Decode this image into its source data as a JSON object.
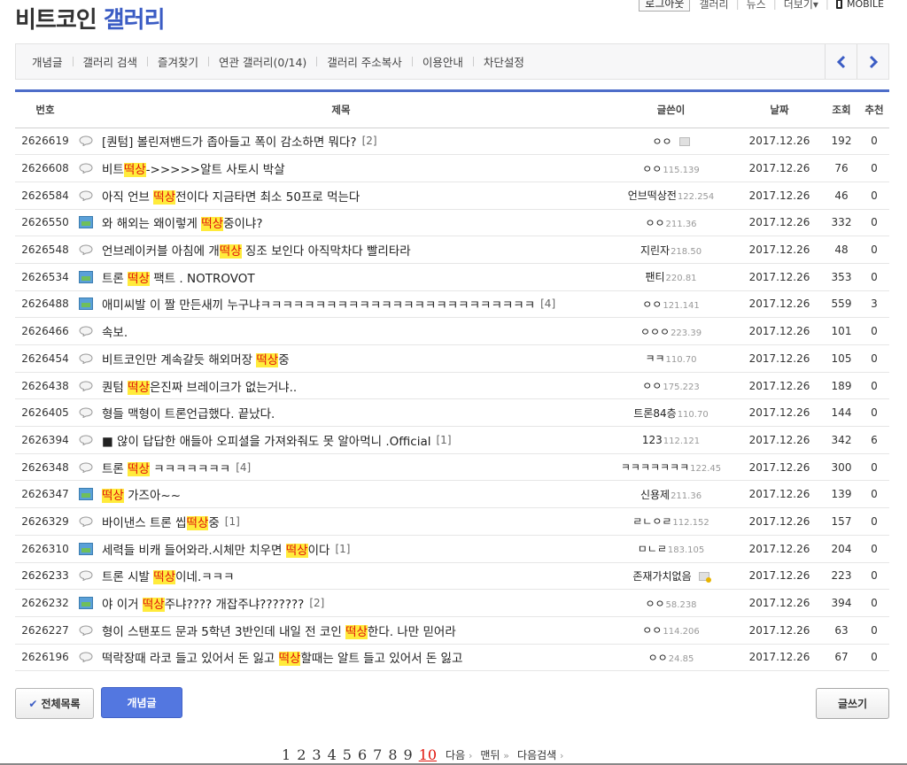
{
  "site": {
    "title_part1": "비트코인",
    "title_part2": "갤러리"
  },
  "topnav": {
    "logout": "로그아웃",
    "gallery": "갤러리",
    "news": "뉴스",
    "more": "더보기",
    "more_caret": "▾",
    "mobile": "MOBILE"
  },
  "menu": {
    "items": [
      "개념글",
      "갤러리 검색",
      "즐겨찾기",
      "연관 갤러리(0/14)",
      "갤러리 주소복사",
      "이용안내",
      "차단설정"
    ]
  },
  "colors": {
    "brand": "#3b5cc4",
    "accent_button": "#5377e0",
    "highlight_bg": "#ffeb3b",
    "highlight_text": "#e0140c"
  },
  "table": {
    "headers": {
      "num": "번호",
      "subject": "제목",
      "writer": "글쓴이",
      "date": "날짜",
      "views": "조회",
      "recommend": "추천"
    },
    "rows": [
      {
        "num": "2626619",
        "icon": "text-icon",
        "parts": [
          {
            "t": "[퀀텀] 볼린져밴드가 좁아들고 폭이 감소하면 뭐다?"
          }
        ],
        "reply": "[2]",
        "writer": "ㅇㅇ",
        "ip": "",
        "badge": "gray",
        "date": "2017.12.26",
        "views": "192",
        "rec": "0"
      },
      {
        "num": "2626608",
        "icon": "text-icon",
        "parts": [
          {
            "t": "비트"
          },
          {
            "t": "떡상",
            "h": true
          },
          {
            "t": "->>>>>알트 사토시 박살"
          }
        ],
        "reply": "",
        "writer": "ㅇㅇ",
        "ip": "115.139",
        "badge": "",
        "date": "2017.12.26",
        "views": "76",
        "rec": "0"
      },
      {
        "num": "2626584",
        "icon": "text-icon",
        "parts": [
          {
            "t": "아직 언브 "
          },
          {
            "t": "떡상",
            "h": true
          },
          {
            "t": "전이다 지금타면 최소 50프로 먹는다"
          }
        ],
        "reply": "",
        "writer": "언브떡상전",
        "ip": "122.254",
        "badge": "",
        "date": "2017.12.26",
        "views": "46",
        "rec": "0"
      },
      {
        "num": "2626550",
        "icon": "image-icon",
        "parts": [
          {
            "t": "와 해외는 왜이렇게 "
          },
          {
            "t": "떡상",
            "h": true
          },
          {
            "t": "중이냐?"
          }
        ],
        "reply": "",
        "writer": "ㅇㅇ",
        "ip": "211.36",
        "badge": "",
        "date": "2017.12.26",
        "views": "332",
        "rec": "0"
      },
      {
        "num": "2626548",
        "icon": "text-icon",
        "parts": [
          {
            "t": "언브레이커블 아침에 개"
          },
          {
            "t": "떡상",
            "h": true
          },
          {
            "t": " 징조 보인다 아직막차다 빨리타라"
          }
        ],
        "reply": "",
        "writer": "지린자",
        "ip": "218.50",
        "badge": "",
        "date": "2017.12.26",
        "views": "48",
        "rec": "0"
      },
      {
        "num": "2626534",
        "icon": "image-icon",
        "parts": [
          {
            "t": "트론 "
          },
          {
            "t": "떡상",
            "h": true
          },
          {
            "t": " 팩트 . NOTROVOT"
          }
        ],
        "reply": "",
        "writer": "팬티",
        "ip": "220.81",
        "badge": "",
        "date": "2017.12.26",
        "views": "353",
        "rec": "0"
      },
      {
        "num": "2626488",
        "icon": "image-icon",
        "parts": [
          {
            "t": "애미씨발 이 짤 만든새끼 누구냐ㅋㅋㅋㅋㅋㅋㅋㅋㅋㅋㅋㅋㅋㅋㅋㅋㅋㅋㅋㅋㅋㅋㅋㅋㅋ"
          }
        ],
        "reply": "[4]",
        "writer": "ㅇㅇ",
        "ip": "121.141",
        "badge": "",
        "date": "2017.12.26",
        "views": "559",
        "rec": "3"
      },
      {
        "num": "2626466",
        "icon": "text-icon",
        "parts": [
          {
            "t": "속보."
          }
        ],
        "reply": "",
        "writer": "ㅇㅇㅇ",
        "ip": "223.39",
        "badge": "",
        "date": "2017.12.26",
        "views": "101",
        "rec": "0"
      },
      {
        "num": "2626454",
        "icon": "text-icon",
        "parts": [
          {
            "t": "비트코인만 계속갈듯 해외머장 "
          },
          {
            "t": "떡상",
            "h": true
          },
          {
            "t": "중"
          }
        ],
        "reply": "",
        "writer": "ㅋㅋ",
        "ip": "110.70",
        "badge": "",
        "date": "2017.12.26",
        "views": "105",
        "rec": "0"
      },
      {
        "num": "2626438",
        "icon": "text-icon",
        "parts": [
          {
            "t": "퀀텀 "
          },
          {
            "t": "떡상",
            "h": true
          },
          {
            "t": "은진짜 브레이크가 없는거냐.."
          }
        ],
        "reply": "",
        "writer": "ㅇㅇ",
        "ip": "175.223",
        "badge": "",
        "date": "2017.12.26",
        "views": "189",
        "rec": "0"
      },
      {
        "num": "2626405",
        "icon": "text-icon",
        "parts": [
          {
            "t": "형들 맥형이 트론언급했다. 끝났다."
          }
        ],
        "reply": "",
        "writer": "트론84층",
        "ip": "110.70",
        "badge": "",
        "date": "2017.12.26",
        "views": "144",
        "rec": "0"
      },
      {
        "num": "2626394",
        "icon": "text-icon",
        "parts": [
          {
            "t": "■ 않이 답답한 애들아 오피셜을 가져와줘도 못 알아먹니 .Official"
          }
        ],
        "reply": "[1]",
        "writer": "123",
        "ip": "112.121",
        "badge": "",
        "date": "2017.12.26",
        "views": "342",
        "rec": "6"
      },
      {
        "num": "2626348",
        "icon": "text-icon",
        "parts": [
          {
            "t": "트론 "
          },
          {
            "t": "떡상",
            "h": true
          },
          {
            "t": " ㅋㅋㅋㅋㅋㅋㅋ"
          }
        ],
        "reply": "[4]",
        "writer": "ㅋㅋㅋㅋㅋㅋㅋ",
        "ip": "122.45",
        "badge": "",
        "date": "2017.12.26",
        "views": "300",
        "rec": "0"
      },
      {
        "num": "2626347",
        "icon": "image-icon",
        "parts": [
          {
            "t": "떡상",
            "h": true
          },
          {
            "t": " 가즈아~~"
          }
        ],
        "reply": "",
        "writer": "신용제",
        "ip": "211.36",
        "badge": "",
        "date": "2017.12.26",
        "views": "139",
        "rec": "0"
      },
      {
        "num": "2626329",
        "icon": "text-icon",
        "parts": [
          {
            "t": "바이낸스 트론 씹"
          },
          {
            "t": "떡상",
            "h": true
          },
          {
            "t": "중"
          }
        ],
        "reply": "[1]",
        "writer": "ㄹㄴㅇㄹ",
        "ip": "112.152",
        "badge": "",
        "date": "2017.12.26",
        "views": "157",
        "rec": "0"
      },
      {
        "num": "2626310",
        "icon": "image-icon",
        "parts": [
          {
            "t": "세력들 비캐 들어와라.시체만 치우면 "
          },
          {
            "t": "떡상",
            "h": true
          },
          {
            "t": "이다"
          }
        ],
        "reply": "[1]",
        "writer": "ㅁㄴㄹ",
        "ip": "183.105",
        "badge": "",
        "date": "2017.12.26",
        "views": "204",
        "rec": "0"
      },
      {
        "num": "2626233",
        "icon": "text-icon",
        "parts": [
          {
            "t": "트론 시발 "
          },
          {
            "t": "떡상",
            "h": true
          },
          {
            "t": "이네.ㅋㅋㅋ"
          }
        ],
        "reply": "",
        "writer": "존재가치없음",
        "ip": "",
        "badge": "gold",
        "date": "2017.12.26",
        "views": "223",
        "rec": "0"
      },
      {
        "num": "2626232",
        "icon": "image-icon",
        "parts": [
          {
            "t": "야 이거 "
          },
          {
            "t": "떡상",
            "h": true
          },
          {
            "t": "주냐???? 개잡주냐???????"
          }
        ],
        "reply": "[2]",
        "writer": "ㅇㅇ",
        "ip": "58.238",
        "badge": "",
        "date": "2017.12.26",
        "views": "394",
        "rec": "0"
      },
      {
        "num": "2626227",
        "icon": "text-icon",
        "parts": [
          {
            "t": "형이 스탠포드 문과 5학년 3반인데 내일 전 코인 "
          },
          {
            "t": "떡상",
            "h": true
          },
          {
            "t": "한다. 나만 믿어라"
          }
        ],
        "reply": "",
        "writer": "ㅇㅇ",
        "ip": "114.206",
        "badge": "",
        "date": "2017.12.26",
        "views": "63",
        "rec": "0"
      },
      {
        "num": "2626196",
        "icon": "text-icon",
        "parts": [
          {
            "t": "떡락장때 라코 들고 있어서 돈 잃고 "
          },
          {
            "t": "떡상",
            "h": true
          },
          {
            "t": "할때는 알트 들고 있어서 돈 잃고"
          }
        ],
        "reply": "",
        "writer": "ㅇㅇ",
        "ip": "24.85",
        "badge": "",
        "date": "2017.12.26",
        "views": "67",
        "rec": "0"
      }
    ]
  },
  "buttons": {
    "all_list": "전체목록",
    "all_list_check": "✔",
    "concept": "개념글",
    "write": "글쓰기"
  },
  "pager": {
    "pages": [
      "1",
      "2",
      "3",
      "4",
      "5",
      "6",
      "7",
      "8",
      "9",
      "10"
    ],
    "current": "10",
    "next": "다음",
    "last": "맨뒤",
    "next_search": "다음검색",
    "gt": "›",
    "dgt": "»"
  }
}
